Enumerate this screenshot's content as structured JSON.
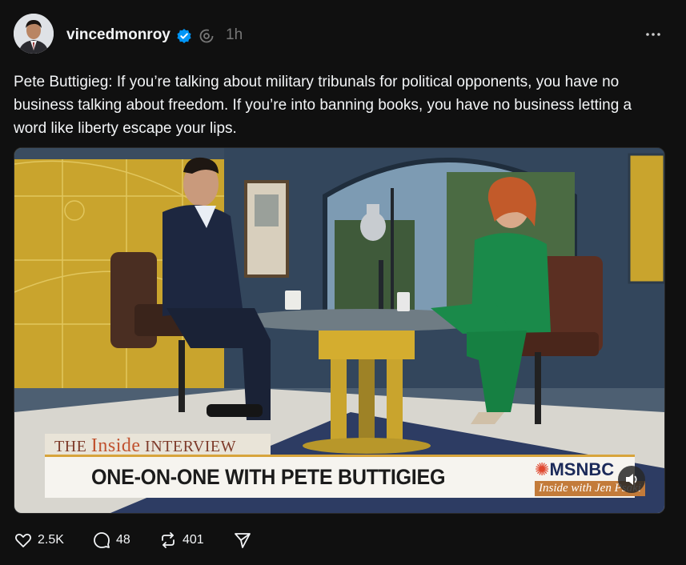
{
  "post": {
    "username": "vincedmonroy",
    "time": "1h",
    "text": "Pete Buttigieg: If you’re talking about military tribunals for political opponents, you have no business talking about freedom. If you’re into banning books, you have no business letting a word like liberty escape your lips."
  },
  "video": {
    "banner_prefix": "THE ",
    "banner_inside": "Inside",
    "banner_suffix": " INTERVIEW",
    "banner_title": "ONE-ON-ONE WITH PETE BUTTIGIEG",
    "network": "MSNBC",
    "show_logo": "Inside with Jen Psaki"
  },
  "actions": {
    "likes": "2.5K",
    "replies": "48",
    "reposts": "401"
  },
  "colors": {
    "background": "#101010",
    "verified": "#0095f6",
    "muted": "#777777"
  },
  "icons": [
    "verified-badge-icon",
    "threads-circle-icon",
    "more-icon",
    "speaker-icon",
    "heart-icon",
    "comment-icon",
    "repost-icon",
    "share-icon"
  ]
}
